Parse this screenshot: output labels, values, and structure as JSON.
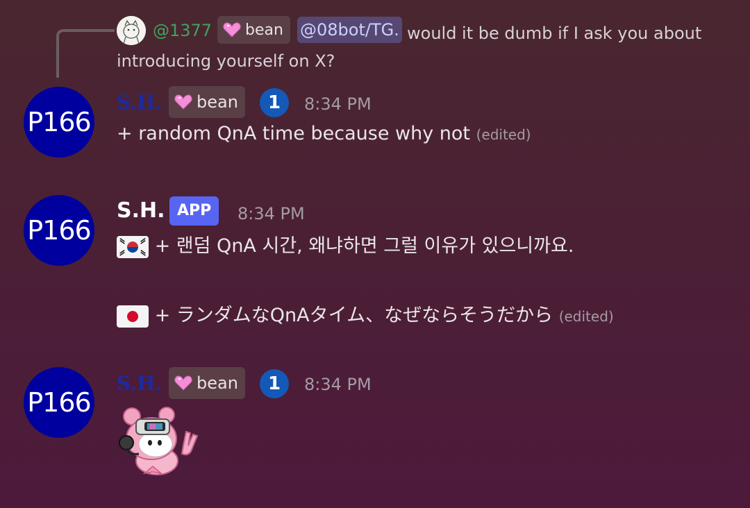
{
  "reply": {
    "username": "@1377",
    "tag_label": "bean",
    "mention": "@08bot/TG.",
    "text": "would it be dumb if I ask you about introducing yourself on X?"
  },
  "messages": [
    {
      "avatar_text": "P166",
      "author": "S.H.",
      "tag_label": "bean",
      "badge_number": "1",
      "time": "8:34 PM",
      "text": "+ random QnA time because why not",
      "edited": "(edited)"
    },
    {
      "avatar_text": "P166",
      "author": "S.H.",
      "app_badge": "APP",
      "time": "8:34 PM",
      "line_ko": "+ 랜덤 QnA 시간, 왜냐하면 그럴 이유가 있으니까요.",
      "line_ja": "+ ランダムなQnAタイム、なぜならそうだから",
      "edited": "(edited)"
    },
    {
      "avatar_text": "P166",
      "author": "S.H.",
      "tag_label": "bean",
      "badge_number": "1",
      "time": "8:34 PM"
    }
  ],
  "colors": {
    "avatar_bg": "#00009e",
    "app_badge": "#5865f2",
    "reply_name": "#3fa35f",
    "mention_bg": "#574873"
  },
  "icons": [
    "pink-heart-icon",
    "korea-flag-icon",
    "japan-flag-icon",
    "bear-sticker"
  ]
}
